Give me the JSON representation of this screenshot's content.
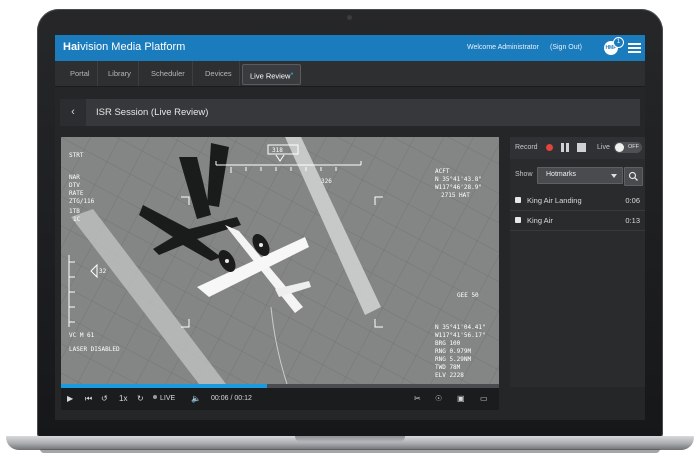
{
  "app": {
    "brand_bold": "Hai",
    "brand_rest": "vision Media Platform",
    "welcome": "Welcome Administrator",
    "signout": "(Sign Out)",
    "notification_count": "1",
    "accent": "#1a7bbd"
  },
  "nav": {
    "items": [
      "Portal",
      "Library",
      "Scheduler",
      "Devices",
      "Live Review"
    ]
  },
  "session": {
    "title": "ISR Session (Live Review)"
  },
  "player": {
    "progress_fraction": 0.47,
    "speed": "1x",
    "live_label": "LIVE",
    "time": "00:06 / 00:12"
  },
  "hud": {
    "heading_box": "318",
    "heading_mark": "326",
    "left_col": [
      "STRT",
      "NAR",
      "DTV",
      "RATE",
      "ZTG/116",
      "1TB",
      "1C"
    ],
    "left_mid": "32",
    "left_low": [
      "VC      M 61",
      "LASER DISABLED"
    ],
    "right_top": [
      "ACFT",
      "N 35°41'43.8\"",
      "W117°46'28.9\"",
      "2715 HAT"
    ],
    "right_mid": "GEE 50",
    "right_low": [
      "N 35°41'04.41\"",
      "W117°41'56.17\"",
      "BRG    100",
      "RNG  0.979M",
      "RNG  5.29NM",
      "TWD     78M",
      "ELV    2228"
    ]
  },
  "panel": {
    "record_label": "Record",
    "live_label": "Live",
    "toggle_text": "OFF",
    "record_color": "#e0443a",
    "show_label": "Show",
    "filter_value": "Hotmarks",
    "hotmarks": [
      {
        "name": "King Air Landing",
        "time": "0:06"
      },
      {
        "name": "King Air",
        "time": "0:13"
      }
    ]
  }
}
